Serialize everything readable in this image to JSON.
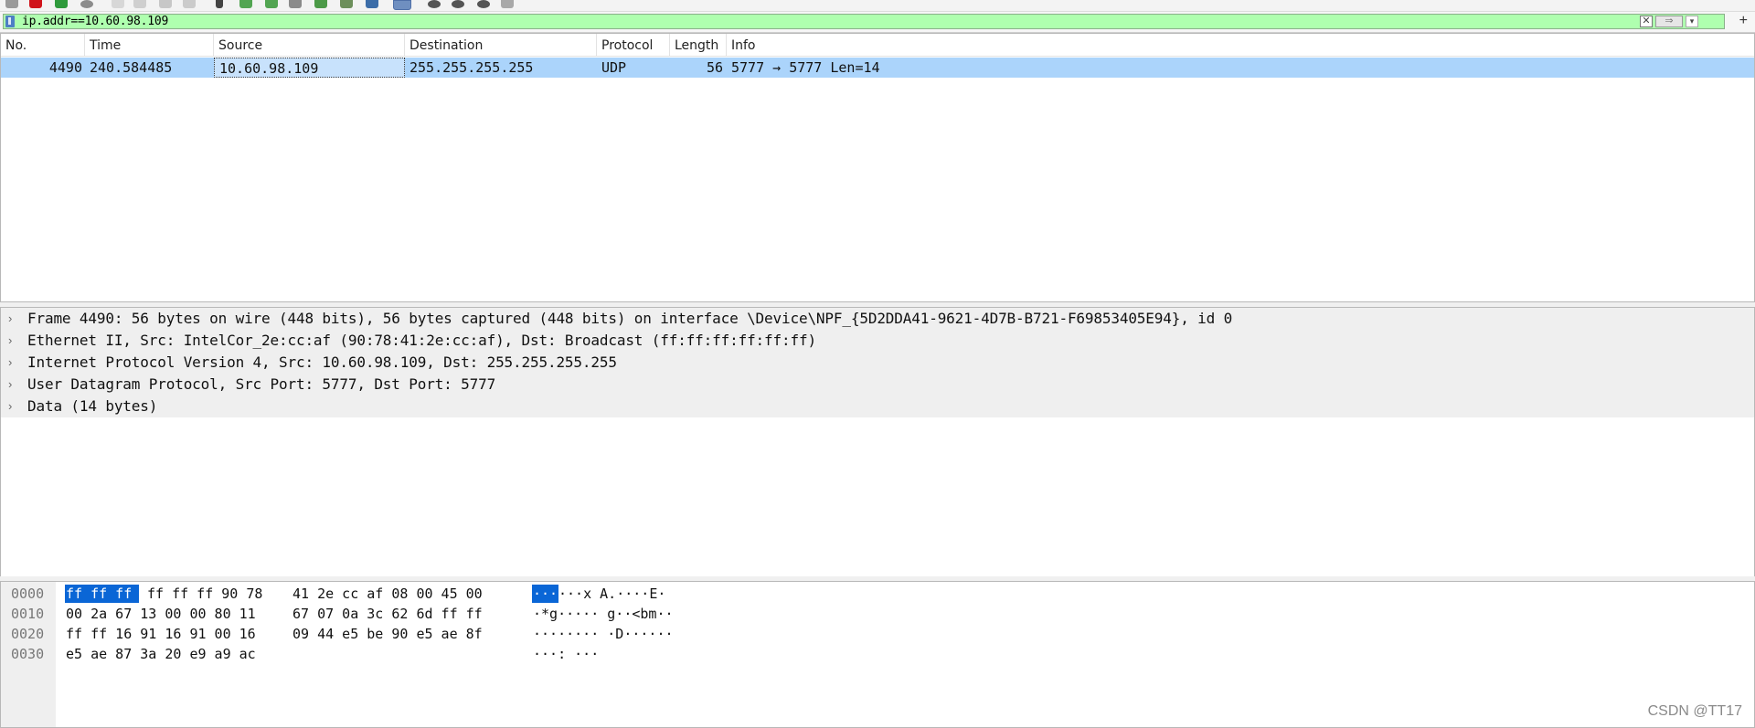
{
  "filter": {
    "text": "ip.addr==10.60.98.109",
    "clear_glyph": "✕",
    "apply_glyph": "⇒",
    "dropdown_glyph": "▾",
    "add_glyph": "+"
  },
  "packet_list": {
    "columns": [
      "No.",
      "Time",
      "Source",
      "Destination",
      "Protocol",
      "Length",
      "Info"
    ],
    "rows": [
      {
        "no": "4490",
        "time": "240.584485",
        "source": "10.60.98.109",
        "destination": "255.255.255.255",
        "protocol": "UDP",
        "length": "56",
        "info": "5777 → 5777 Len=14"
      }
    ],
    "selected_row_color": "#abd4fb"
  },
  "details": {
    "expand_glyph": "›",
    "items": [
      "Frame 4490: 56 bytes on wire (448 bits), 56 bytes captured (448 bits) on interface \\Device\\NPF_{5D2DDA41-9621-4D7B-B721-F69853405E94}, id 0",
      "Ethernet II, Src: IntelCor_2e:cc:af (90:78:41:2e:cc:af), Dst: Broadcast (ff:ff:ff:ff:ff:ff)",
      "Internet Protocol Version 4, Src: 10.60.98.109, Dst: 255.255.255.255",
      "User Datagram Protocol, Src Port: 5777, Dst Port: 5777",
      "Data (14 bytes)"
    ]
  },
  "bytes": {
    "lines": [
      {
        "offset": "0000",
        "hex_sel": "ff ff ff",
        "hex_a": "ff ff ff 90 78",
        "hex_b": "41 2e cc af 08 00 45 00",
        "ascii_sel": "···",
        "ascii": "···x A.····E·"
      },
      {
        "offset": "0010",
        "hex_a": "00 2a 67 13 00 00 80 11",
        "hex_b": "67 07 0a 3c 62 6d ff ff",
        "ascii": "·*g····· g··<bm··"
      },
      {
        "offset": "0020",
        "hex_a": "ff ff 16 91 16 91 00 16",
        "hex_b": "09 44 e5 be 90 e5 ae 8f",
        "ascii": "········ ·D······"
      },
      {
        "offset": "0030",
        "hex_a": "e5 ae 87 3a 20 e9 a9 ac",
        "hex_b": "",
        "ascii": "···: ···"
      }
    ],
    "highlight_color": "#0a66d6"
  },
  "watermark": "CSDN @TT17"
}
